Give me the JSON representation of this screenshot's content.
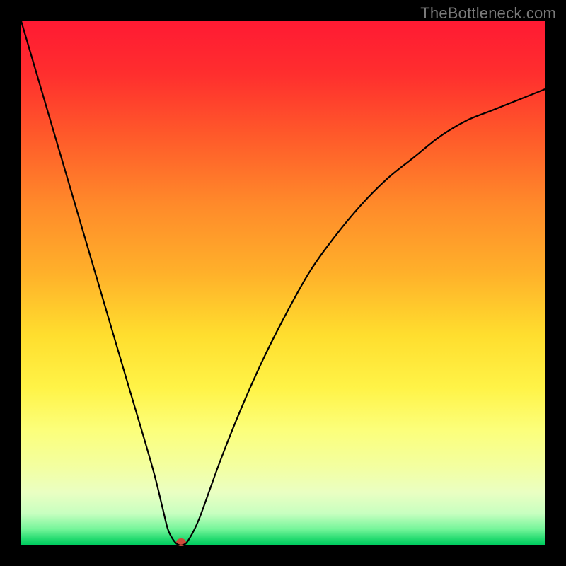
{
  "watermark": "TheBottleneck.com",
  "chart_data": {
    "type": "line",
    "title": "",
    "xlabel": "",
    "ylabel": "",
    "xlim": [
      0,
      100
    ],
    "ylim": [
      0,
      100
    ],
    "x": [
      0,
      5,
      10,
      15,
      20,
      25,
      27,
      28,
      29,
      30,
      31,
      32,
      34,
      38,
      42,
      46,
      50,
      55,
      60,
      65,
      70,
      75,
      80,
      85,
      90,
      95,
      100
    ],
    "y": [
      100,
      83,
      66,
      49,
      32,
      15,
      7,
      3,
      1,
      0,
      0,
      1,
      5,
      16,
      26,
      35,
      43,
      52,
      59,
      65,
      70,
      74,
      78,
      81,
      83,
      85,
      87
    ],
    "marker": {
      "x": 30.5,
      "y": 0.5
    },
    "gradient_stops": [
      {
        "pos": 0,
        "color": "#ff1a33"
      },
      {
        "pos": 60,
        "color": "#ffde2e"
      },
      {
        "pos": 100,
        "color": "#00cc5f"
      }
    ]
  }
}
